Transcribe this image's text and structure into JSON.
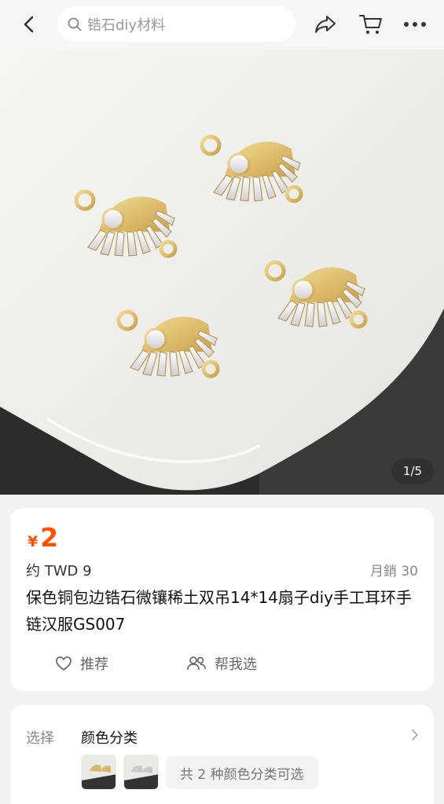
{
  "search": {
    "placeholder": "锆石diy材料"
  },
  "gallery": {
    "counter": "1/5"
  },
  "product": {
    "currency": "¥",
    "price": "2",
    "approx_price": "约 TWD 9",
    "monthly_sales": "月銷 30",
    "title": "保色铜包边锆石微镶稀土双吊14*14扇子diy手工耳环手链汉服GS007"
  },
  "actions": {
    "recommend": "推荐",
    "help_choose": "帮我选"
  },
  "selection": {
    "label": "选择",
    "value": "颜色分类",
    "count_text": "共 2 种颜色分类可选"
  },
  "colors": {
    "accent": "#ff5000"
  },
  "icons": [
    "back-icon",
    "search-icon",
    "share-icon",
    "cart-icon",
    "more-icon",
    "heart-icon",
    "people-icon",
    "chevron-right-icon"
  ]
}
